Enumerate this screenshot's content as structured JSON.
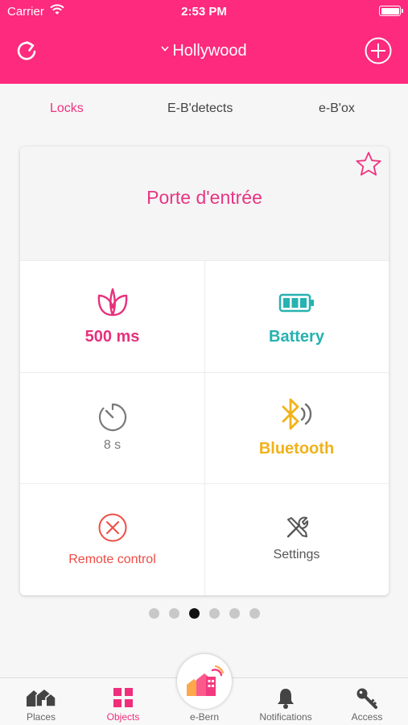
{
  "status_bar": {
    "carrier": "Carrier",
    "time": "2:53 PM"
  },
  "header": {
    "place": "Hollywood",
    "refresh_icon": "refresh-icon",
    "add_icon": "plus-circle-icon"
  },
  "tabs": [
    {
      "label": "Locks",
      "active": true
    },
    {
      "label": "E-B'detects",
      "active": false
    },
    {
      "label": "e-B'ox",
      "active": false
    }
  ],
  "card": {
    "title": "Porte d'entrée",
    "favorite_icon": "star-outline-icon",
    "cells": {
      "eco": {
        "label": "500 ms",
        "icon": "leaf-icon",
        "color": "#e6317c"
      },
      "battery": {
        "label": "Battery",
        "icon": "battery-icon",
        "color": "#26b2b0"
      },
      "timer": {
        "label": "8 s",
        "icon": "timer-icon",
        "color": "#7a7a7a"
      },
      "bluetooth": {
        "label": "Bluetooth",
        "icon": "bluetooth-icon",
        "color": "#f1b21a"
      },
      "remote": {
        "label": "Remote control",
        "icon": "close-circle-icon",
        "color": "#ef4c44"
      },
      "settings": {
        "label": "Settings",
        "icon": "tools-icon",
        "color": "#555555"
      }
    }
  },
  "pager": {
    "count": 6,
    "active_index": 2
  },
  "bottom_nav": [
    {
      "label": "Places",
      "icon": "houses-icon",
      "active": false
    },
    {
      "label": "Objects",
      "icon": "grid-icon",
      "active": true
    },
    {
      "label": "e-Bern",
      "icon": "e-bern-logo-icon",
      "active": false
    },
    {
      "label": "Notifications",
      "icon": "bell-icon",
      "active": false
    },
    {
      "label": "Access",
      "icon": "key-icon",
      "active": false
    }
  ],
  "colors": {
    "brand": "#fd2a7d",
    "accent_text": "#e63584"
  }
}
